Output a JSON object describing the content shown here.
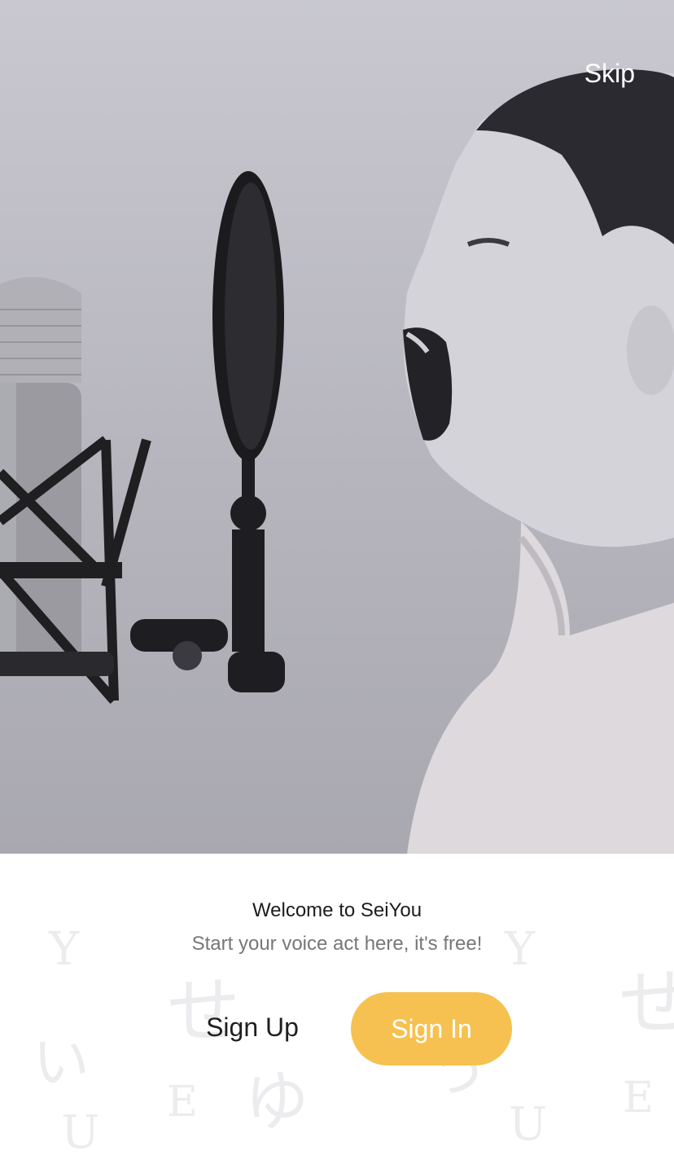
{
  "hero": {
    "skip_label": "Skip"
  },
  "welcome": {
    "title": "Welcome to SeiYou",
    "subtitle": "Start your voice act here, it's free!"
  },
  "actions": {
    "sign_up_label": "Sign Up",
    "sign_in_label": "Sign In"
  },
  "pattern": {
    "glyphs": [
      "Y",
      "せ",
      "い",
      "ゆ",
      "う",
      "E",
      "U"
    ]
  },
  "colors": {
    "accent": "#f6c150",
    "title_text": "#1c1c1c",
    "subtitle_text": "#777777",
    "pattern_glyph": "#ecebee"
  }
}
